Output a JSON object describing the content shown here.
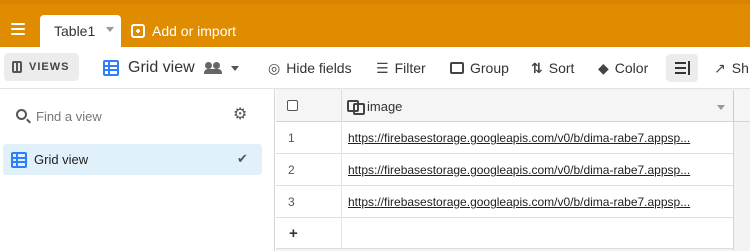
{
  "topbar": {
    "table_tab": "Table1",
    "add_import": "Add or import"
  },
  "toolbar": {
    "views_label": "VIEWS",
    "view_name": "Grid view",
    "hide_fields": "Hide fields",
    "filter": "Filter",
    "group": "Group",
    "sort": "Sort",
    "color": "Color",
    "share_partial": "Sh"
  },
  "sidebar": {
    "search_placeholder": "Find a view",
    "views": [
      {
        "label": "Grid view",
        "selected": true
      }
    ]
  },
  "grid": {
    "field_name": "image",
    "rows": [
      {
        "num": "1",
        "value": "https://firebasestorage.googleapis.com/v0/b/dima-rabe7.appsp..."
      },
      {
        "num": "2",
        "value": "https://firebasestorage.googleapis.com/v0/b/dima-rabe7.appsp..."
      },
      {
        "num": "3",
        "value": "https://firebasestorage.googleapis.com/v0/b/dima-rabe7.appsp..."
      }
    ],
    "add_row_symbol": "+"
  },
  "colors": {
    "topbar": "#e08c00",
    "accent_blue": "#2d7ff9",
    "selected_view_bg": "#e1f1fb"
  }
}
